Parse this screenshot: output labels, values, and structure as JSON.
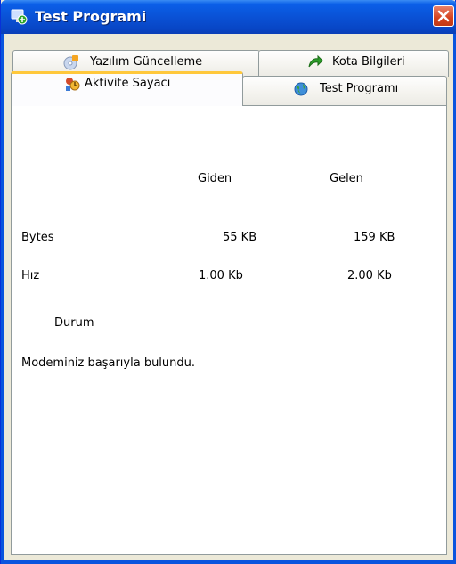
{
  "window": {
    "title": "Test Programi"
  },
  "tabs": {
    "back_row": [
      {
        "label": "Yazılım Güncelleme",
        "icon": "update-disc-icon"
      },
      {
        "label": "Kota Bilgileri",
        "icon": "green-arrow-icon"
      }
    ],
    "front_row": [
      {
        "label": "Aktivite Sayacı",
        "icon": "activity-counter-icon",
        "active": true
      },
      {
        "label": "Test Programı",
        "icon": "globe-test-icon"
      }
    ]
  },
  "stats": {
    "col_sent": "Giden",
    "col_received": "Gelen",
    "rows": [
      {
        "label": "Bytes",
        "sent": "55 KB",
        "received": "159 KB"
      },
      {
        "label": "Hız",
        "sent": "1.00 Kb",
        "received": "2.00 Kb"
      }
    ]
  },
  "status": {
    "heading": "Durum",
    "message": "Modeminiz başarıyla bulundu."
  }
}
